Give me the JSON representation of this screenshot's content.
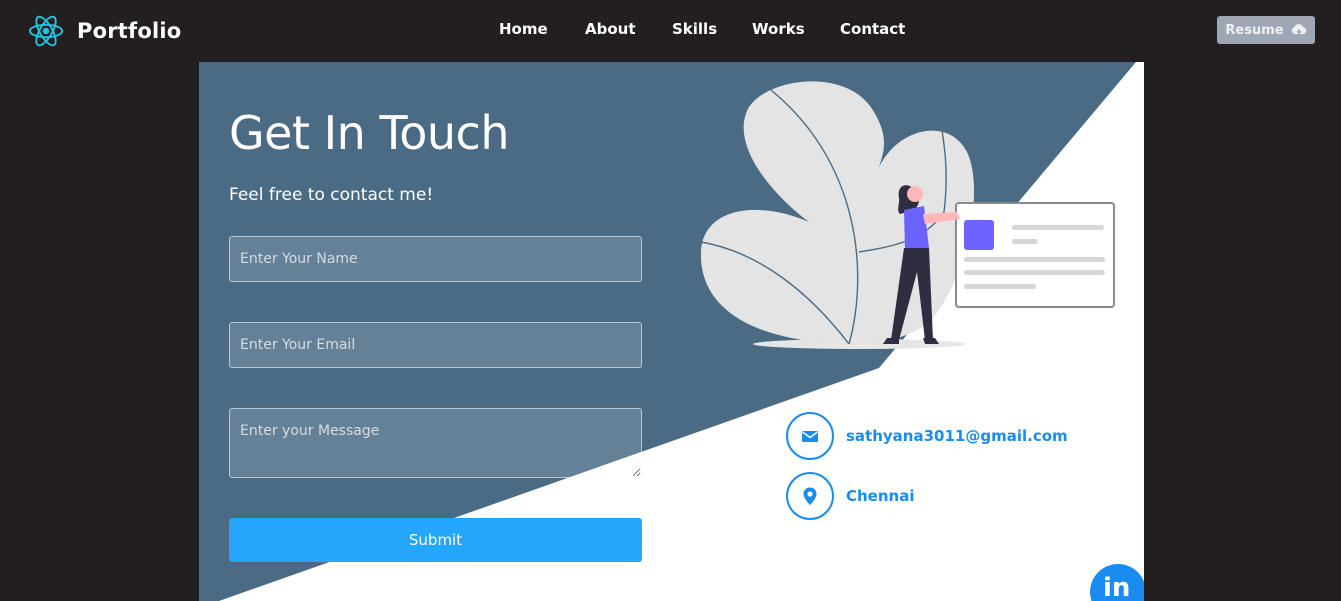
{
  "navbar": {
    "brand": "Portfolio",
    "brand_icon": "react-atom-icon",
    "links": [
      "Home",
      "About",
      "Skills",
      "Works",
      "Contact"
    ],
    "resume_label": "Resume",
    "resume_icon": "cloud-download-icon"
  },
  "contact": {
    "title": "Get In Touch",
    "subtitle": "Feel free to contact me!",
    "name_placeholder": "Enter Your Name",
    "email_placeholder": "Enter Your Email",
    "message_placeholder": "Enter your Message",
    "submit_label": "Submit",
    "email": "sathyana3011@gmail.com",
    "location": "Chennai",
    "email_icon": "mail-icon",
    "location_icon": "map-pin-icon",
    "social_icon": "linkedin-icon",
    "social_label": "in"
  },
  "colors": {
    "page_bg": "#231f20",
    "card_panel": "#4b6b85",
    "accent": "#24a6fc",
    "info_blue": "#1a8cf0",
    "resume_bg": "#9ea7b3"
  }
}
